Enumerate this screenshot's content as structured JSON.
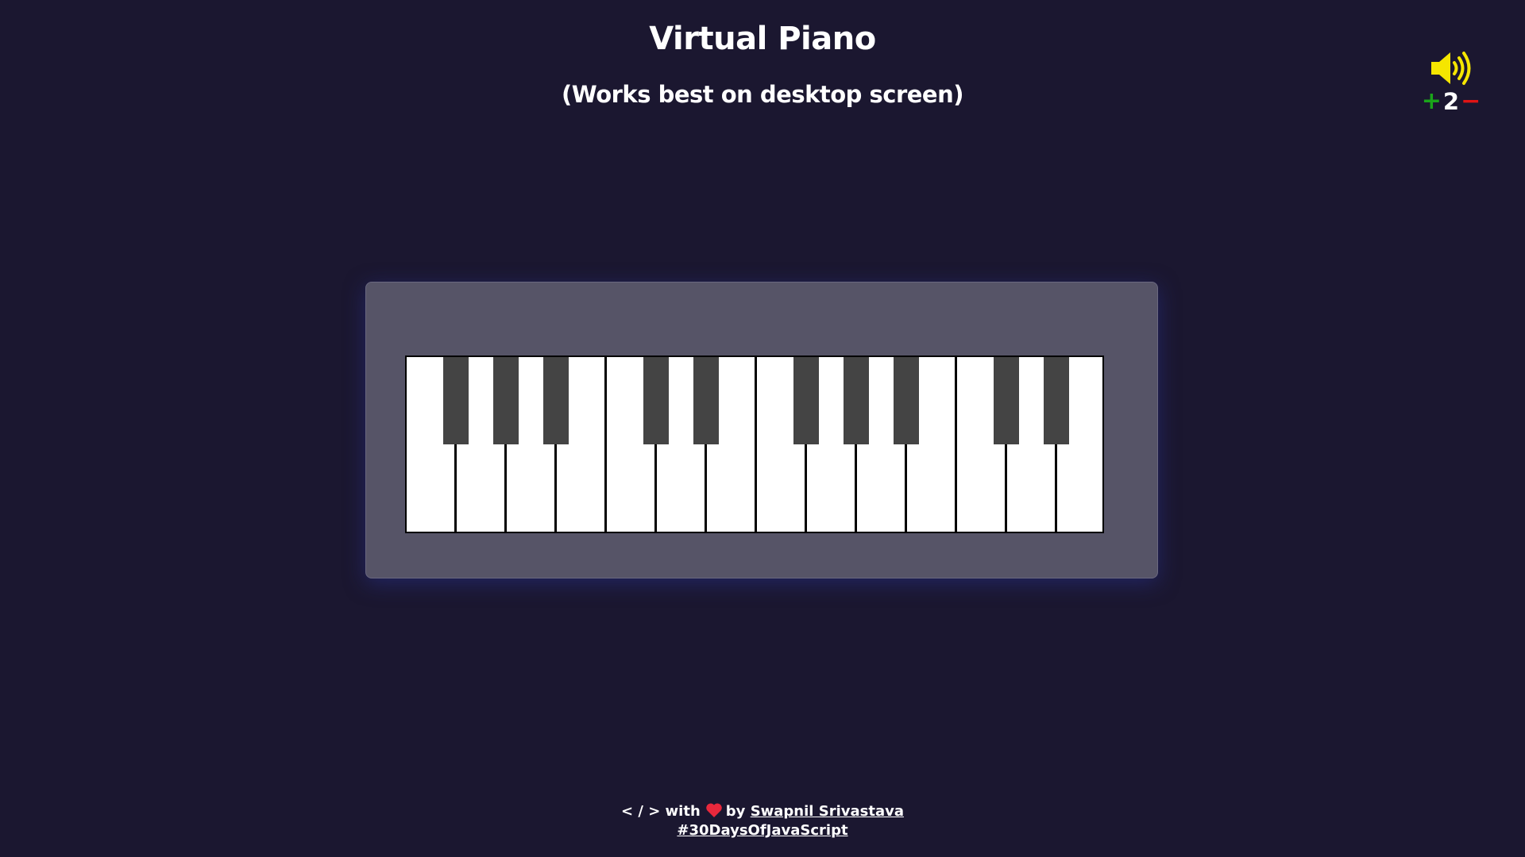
{
  "header": {
    "title": "Virtual Piano",
    "subtitle": "(Works best on desktop screen)"
  },
  "volume": {
    "icon": "speaker-volume-icon",
    "plus_label": "+",
    "value": "2",
    "minus_label": "−",
    "icon_color": "#f5e600",
    "plus_color": "#1aa51a",
    "minus_color": "#e01414"
  },
  "piano": {
    "white_key_count": 14,
    "black_key_count": 10,
    "case_color": "#565467",
    "white_key_color": "#ffffff",
    "black_key_color": "#444444"
  },
  "footer": {
    "code_symbol": "< / > with",
    "heart_icon": "heart-icon",
    "by_text": "by",
    "author_link": "Swapnil Srivastava",
    "hashtag_link": "#30DaysOfJavaScript"
  },
  "colors": {
    "background": "#1b1730",
    "text": "#ffffff"
  }
}
